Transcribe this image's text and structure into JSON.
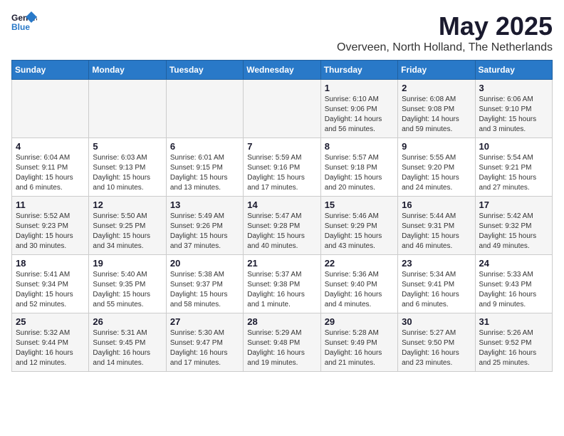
{
  "header": {
    "logo_general": "General",
    "logo_blue": "Blue",
    "month_year": "May 2025",
    "location": "Overveen, North Holland, The Netherlands"
  },
  "weekdays": [
    "Sunday",
    "Monday",
    "Tuesday",
    "Wednesday",
    "Thursday",
    "Friday",
    "Saturday"
  ],
  "weeks": [
    [
      {
        "num": "",
        "info": ""
      },
      {
        "num": "",
        "info": ""
      },
      {
        "num": "",
        "info": ""
      },
      {
        "num": "",
        "info": ""
      },
      {
        "num": "1",
        "info": "Sunrise: 6:10 AM\nSunset: 9:06 PM\nDaylight: 14 hours\nand 56 minutes."
      },
      {
        "num": "2",
        "info": "Sunrise: 6:08 AM\nSunset: 9:08 PM\nDaylight: 14 hours\nand 59 minutes."
      },
      {
        "num": "3",
        "info": "Sunrise: 6:06 AM\nSunset: 9:10 PM\nDaylight: 15 hours\nand 3 minutes."
      }
    ],
    [
      {
        "num": "4",
        "info": "Sunrise: 6:04 AM\nSunset: 9:11 PM\nDaylight: 15 hours\nand 6 minutes."
      },
      {
        "num": "5",
        "info": "Sunrise: 6:03 AM\nSunset: 9:13 PM\nDaylight: 15 hours\nand 10 minutes."
      },
      {
        "num": "6",
        "info": "Sunrise: 6:01 AM\nSunset: 9:15 PM\nDaylight: 15 hours\nand 13 minutes."
      },
      {
        "num": "7",
        "info": "Sunrise: 5:59 AM\nSunset: 9:16 PM\nDaylight: 15 hours\nand 17 minutes."
      },
      {
        "num": "8",
        "info": "Sunrise: 5:57 AM\nSunset: 9:18 PM\nDaylight: 15 hours\nand 20 minutes."
      },
      {
        "num": "9",
        "info": "Sunrise: 5:55 AM\nSunset: 9:20 PM\nDaylight: 15 hours\nand 24 minutes."
      },
      {
        "num": "10",
        "info": "Sunrise: 5:54 AM\nSunset: 9:21 PM\nDaylight: 15 hours\nand 27 minutes."
      }
    ],
    [
      {
        "num": "11",
        "info": "Sunrise: 5:52 AM\nSunset: 9:23 PM\nDaylight: 15 hours\nand 30 minutes."
      },
      {
        "num": "12",
        "info": "Sunrise: 5:50 AM\nSunset: 9:25 PM\nDaylight: 15 hours\nand 34 minutes."
      },
      {
        "num": "13",
        "info": "Sunrise: 5:49 AM\nSunset: 9:26 PM\nDaylight: 15 hours\nand 37 minutes."
      },
      {
        "num": "14",
        "info": "Sunrise: 5:47 AM\nSunset: 9:28 PM\nDaylight: 15 hours\nand 40 minutes."
      },
      {
        "num": "15",
        "info": "Sunrise: 5:46 AM\nSunset: 9:29 PM\nDaylight: 15 hours\nand 43 minutes."
      },
      {
        "num": "16",
        "info": "Sunrise: 5:44 AM\nSunset: 9:31 PM\nDaylight: 15 hours\nand 46 minutes."
      },
      {
        "num": "17",
        "info": "Sunrise: 5:42 AM\nSunset: 9:32 PM\nDaylight: 15 hours\nand 49 minutes."
      }
    ],
    [
      {
        "num": "18",
        "info": "Sunrise: 5:41 AM\nSunset: 9:34 PM\nDaylight: 15 hours\nand 52 minutes."
      },
      {
        "num": "19",
        "info": "Sunrise: 5:40 AM\nSunset: 9:35 PM\nDaylight: 15 hours\nand 55 minutes."
      },
      {
        "num": "20",
        "info": "Sunrise: 5:38 AM\nSunset: 9:37 PM\nDaylight: 15 hours\nand 58 minutes."
      },
      {
        "num": "21",
        "info": "Sunrise: 5:37 AM\nSunset: 9:38 PM\nDaylight: 16 hours\nand 1 minute."
      },
      {
        "num": "22",
        "info": "Sunrise: 5:36 AM\nSunset: 9:40 PM\nDaylight: 16 hours\nand 4 minutes."
      },
      {
        "num": "23",
        "info": "Sunrise: 5:34 AM\nSunset: 9:41 PM\nDaylight: 16 hours\nand 6 minutes."
      },
      {
        "num": "24",
        "info": "Sunrise: 5:33 AM\nSunset: 9:43 PM\nDaylight: 16 hours\nand 9 minutes."
      }
    ],
    [
      {
        "num": "25",
        "info": "Sunrise: 5:32 AM\nSunset: 9:44 PM\nDaylight: 16 hours\nand 12 minutes."
      },
      {
        "num": "26",
        "info": "Sunrise: 5:31 AM\nSunset: 9:45 PM\nDaylight: 16 hours\nand 14 minutes."
      },
      {
        "num": "27",
        "info": "Sunrise: 5:30 AM\nSunset: 9:47 PM\nDaylight: 16 hours\nand 17 minutes."
      },
      {
        "num": "28",
        "info": "Sunrise: 5:29 AM\nSunset: 9:48 PM\nDaylight: 16 hours\nand 19 minutes."
      },
      {
        "num": "29",
        "info": "Sunrise: 5:28 AM\nSunset: 9:49 PM\nDaylight: 16 hours\nand 21 minutes."
      },
      {
        "num": "30",
        "info": "Sunrise: 5:27 AM\nSunset: 9:50 PM\nDaylight: 16 hours\nand 23 minutes."
      },
      {
        "num": "31",
        "info": "Sunrise: 5:26 AM\nSunset: 9:52 PM\nDaylight: 16 hours\nand 25 minutes."
      }
    ]
  ]
}
